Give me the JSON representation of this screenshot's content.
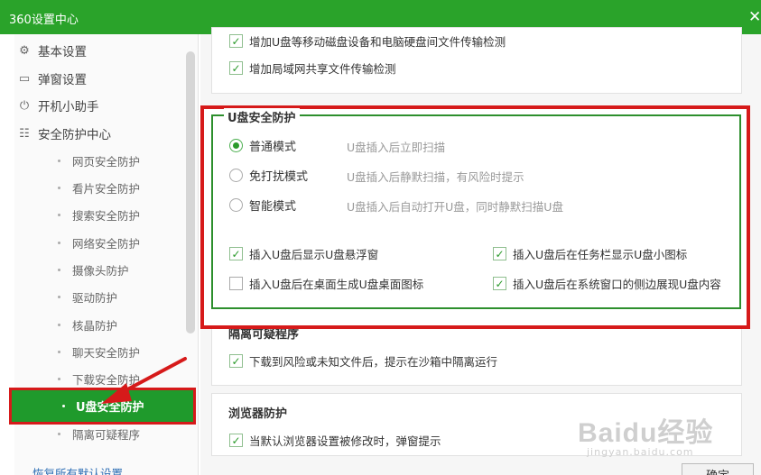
{
  "window": {
    "title": "360设置中心",
    "close_label": "✕"
  },
  "sidebar": {
    "top_items": [
      {
        "label": "基本设置",
        "icon": "gear-icon",
        "glyph": "⚙"
      },
      {
        "label": "弹窗设置",
        "icon": "window-icon",
        "glyph": "▭"
      },
      {
        "label": "开机小助手",
        "icon": "power-icon",
        "glyph": "⏻"
      },
      {
        "label": "安全防护中心",
        "icon": "shield-settings-icon",
        "glyph": "☷"
      }
    ],
    "sub_items": [
      {
        "label": "网页安全防护"
      },
      {
        "label": "看片安全防护"
      },
      {
        "label": "搜索安全防护"
      },
      {
        "label": "网络安全防护"
      },
      {
        "label": "摄像头防护"
      },
      {
        "label": "驱动防护"
      },
      {
        "label": "核晶防护"
      },
      {
        "label": "聊天安全防护"
      },
      {
        "label": "下载安全防护"
      },
      {
        "label": "U盘安全防护"
      },
      {
        "label": "隔离可疑程序"
      }
    ],
    "active_label": "U盘安全防护"
  },
  "top_card": {
    "items": [
      {
        "label": "增加U盘等移动磁盘设备和电脑硬盘间文件传输检测",
        "checked": true
      },
      {
        "label": "增加局域网共享文件传输检测",
        "checked": true
      }
    ]
  },
  "usb_protection": {
    "title": "U盘安全防护",
    "modes": [
      {
        "label": "普通模式",
        "desc": "U盘插入后立即扫描",
        "selected": true
      },
      {
        "label": "免打扰模式",
        "desc": "U盘插入后静默扫描，有风险时提示",
        "selected": false
      },
      {
        "label": "智能模式",
        "desc": "U盘插入后自动打开U盘，同时静默扫描U盘",
        "selected": false
      }
    ],
    "options": [
      {
        "label": "插入U盘后显示U盘悬浮窗",
        "checked": true
      },
      {
        "label": "插入U盘后在任务栏显示U盘小图标",
        "checked": true
      },
      {
        "label": "插入U盘后在桌面生成U盘桌面图标",
        "checked": false
      },
      {
        "label": "插入U盘后在系统窗口的侧边展现U盘内容",
        "checked": true
      }
    ]
  },
  "quarantine": {
    "title": "隔离可疑程序",
    "items": [
      {
        "label": "下载到风险或未知文件后，提示在沙箱中隔离运行",
        "checked": true
      }
    ]
  },
  "browser_protection": {
    "title": "浏览器防护",
    "items": [
      {
        "label": "当默认浏览器设置被修改时，弹窗提示",
        "checked": true
      }
    ]
  },
  "footer": {
    "restore_link": "恢复所有默认设置",
    "ok_label": "确定"
  },
  "watermark": {
    "brand": "Baidu经验",
    "url": "jingyan.baidu.com"
  },
  "colors": {
    "brand_green": "#2aa32a",
    "active_green": "#1f9a2c",
    "highlight_red": "#d61a1a"
  }
}
